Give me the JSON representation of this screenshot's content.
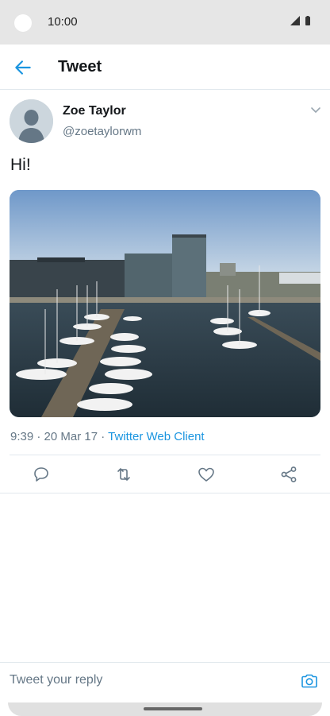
{
  "status_bar": {
    "time": "10:00"
  },
  "app_bar": {
    "title": "Tweet"
  },
  "tweet": {
    "author_name": "Zoe Taylor",
    "author_handle": "@zoetaylorwm",
    "text": "Hi!",
    "time": "9:39",
    "date": "20 Mar 17",
    "source": "Twitter Web Client",
    "separator": " · "
  },
  "reply": {
    "placeholder": "Tweet your reply"
  },
  "colors": {
    "accent": "#1b95e0",
    "secondary_text": "#657786",
    "divider": "#e1e8ed"
  },
  "icons": {
    "back": "arrow-left-icon",
    "more": "chevron-down-icon",
    "reply": "comment-icon",
    "retweet": "retweet-icon",
    "like": "heart-icon",
    "share": "share-icon",
    "camera": "camera-icon"
  }
}
